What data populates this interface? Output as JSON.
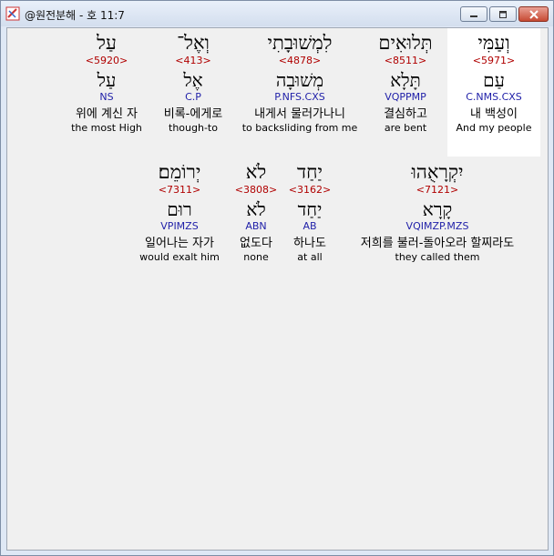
{
  "window": {
    "title": "@원전분해 - 호 11:7"
  },
  "words": [
    {
      "hebrew": "וְעַמִּי",
      "strong": "<5971>",
      "lemma": "עַם",
      "morph": "C.NMS.CXS",
      "korean": "내 백성이",
      "english": "And my people"
    },
    {
      "hebrew": "תְּלוּאִים",
      "strong": "<8511>",
      "lemma": "תָּלָא",
      "morph": "VQPPMP",
      "korean": "결심하고",
      "english": "are bent"
    },
    {
      "hebrew": "לִמְשׁוּבָתִי",
      "strong": "<4878>",
      "lemma": "מְשׁוּבָה",
      "morph": "P.NFS.CXS",
      "korean": "내게서 물러가나니",
      "english": "to backsliding from me"
    },
    {
      "hebrew": "וְאֶל־",
      "strong": "<413>",
      "lemma": "אֶל",
      "morph": "C.P",
      "korean": "비록-에게로",
      "english": "though-to"
    },
    {
      "hebrew": "עַל",
      "strong": "<5920>",
      "lemma": "עַל",
      "morph": "NS",
      "korean": "위에 계신 자",
      "english": "the most High"
    },
    {
      "hebrew": "יִקְרָאֻהוּ",
      "strong": "<7121>",
      "lemma": "קָרָא",
      "morph": "VQIMZP.MZS",
      "korean": "저희를 불러-돌아오라 할찌라도",
      "english": "they called them"
    },
    {
      "hebrew": "יַחַד",
      "strong": "<3162>",
      "lemma": "יַחַד",
      "morph": "AB",
      "korean": "하나도",
      "english": "at all"
    },
    {
      "hebrew": "לֹא",
      "strong": "<3808>",
      "lemma": "לֹא",
      "morph": "ABN",
      "korean": "없도다",
      "english": "none"
    },
    {
      "hebrew": "יְרוֹמֵם׃",
      "strong": "<7311>",
      "lemma": "רוּם",
      "morph": "VPIMZS",
      "korean": "일어나는 자가",
      "english": "would exalt him"
    }
  ]
}
